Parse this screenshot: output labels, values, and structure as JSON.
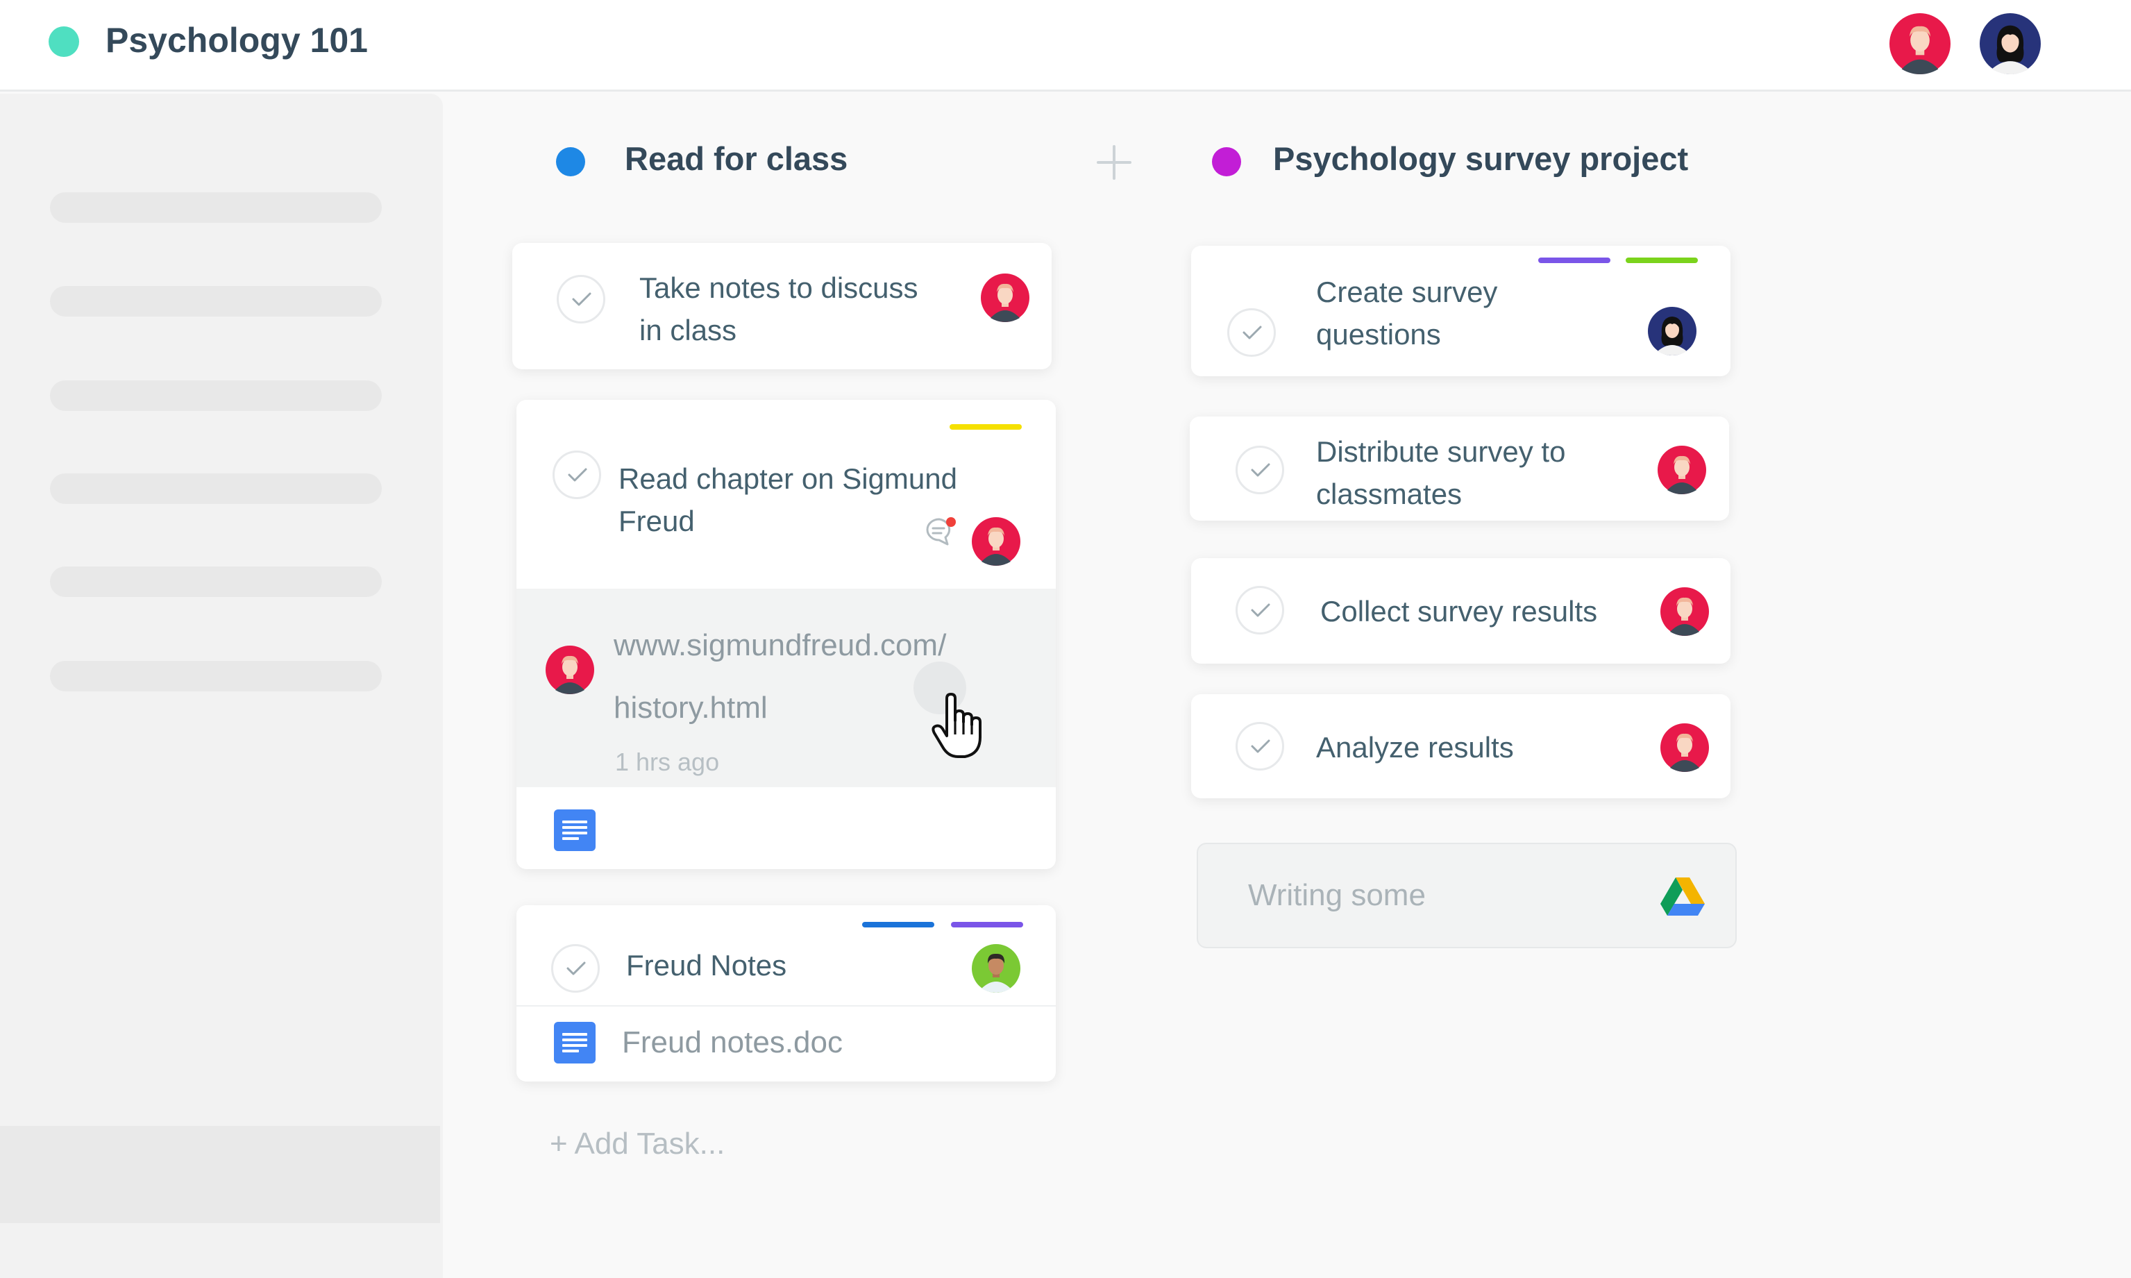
{
  "header": {
    "project_title": "Psychology 101",
    "project_color": "#4fdfc1"
  },
  "columns": [
    {
      "title": "Read for class",
      "color": "#1e88e5",
      "tasks": [
        {
          "text": [
            "Take notes to discuss",
            "in class"
          ],
          "assignee": "man-red"
        },
        {
          "text": [
            "Read chapter on Sigmund",
            "Freud"
          ],
          "assignee": "man-red",
          "tags": [
            "#f5e000"
          ],
          "comment": {
            "link_lines": [
              "www.sigmundfreud.com/",
              "history.html"
            ],
            "time": "1 hrs ago",
            "author": "man-red"
          },
          "attachment_icon": "google-docs-icon"
        },
        {
          "text": [
            "Freud Notes"
          ],
          "assignee": "man-green",
          "tags": [
            "#1a73d9",
            "#7a55e8"
          ],
          "attachment": "Freud notes.doc",
          "attachment_icon": "google-docs-icon"
        }
      ],
      "add_task": "+ Add Task..."
    },
    {
      "title": "Psychology survey project",
      "color": "#c21ed6",
      "tasks": [
        {
          "text": [
            "Create survey",
            "questions"
          ],
          "assignee": "woman-navy",
          "tags": [
            "#7a55e8",
            "#7bd31c"
          ]
        },
        {
          "text": [
            "Distribute survey to",
            "classmates"
          ],
          "assignee": "man-red"
        },
        {
          "text": [
            "Collect survey results"
          ],
          "assignee": "man-red"
        },
        {
          "text": [
            "Analyze results"
          ],
          "assignee": "man-red"
        }
      ],
      "draft": {
        "text": "Writing some",
        "icon": "google-drive-icon"
      }
    }
  ],
  "colors": {
    "avatar_red": "#e8194a",
    "avatar_navy": "#27337a",
    "avatar_green": "#7bc934",
    "check_mark": "#9ca9b0"
  }
}
